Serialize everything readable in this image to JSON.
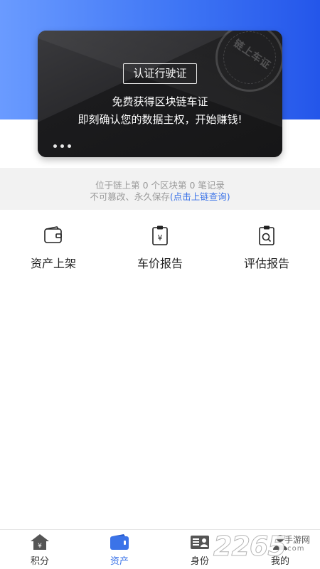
{
  "hero": {
    "certify_button": "认证行驶证",
    "line1": "免费获得区块链车证",
    "line2": "即刻确认您的数据主权，开始赚钱!",
    "seal_text": "链上车证",
    "colors": {
      "gradient_start": "#6a9bff",
      "gradient_end": "#2456ea",
      "card": "#1e1e20"
    }
  },
  "chain": {
    "record_line": "位于链上第 0 个区块第 0 笔记录",
    "tamper_prefix": "不可篡改、永久保存",
    "query_link": "(点击上链查询)"
  },
  "features": [
    {
      "label": "资产上架",
      "icon": "wallet-icon"
    },
    {
      "label": "车价报告",
      "icon": "price-report-icon"
    },
    {
      "label": "评估报告",
      "icon": "evaluation-report-icon"
    }
  ],
  "tabs": [
    {
      "label": "积分",
      "icon": "points-home-icon"
    },
    {
      "label": "资产",
      "icon": "asset-wallet-icon",
      "active": true
    },
    {
      "label": "身份",
      "icon": "id-card-icon"
    },
    {
      "label": "我的",
      "icon": "user-icon"
    }
  ],
  "watermark": {
    "number": "2265",
    "site_cn": "手游网",
    "site_en": ".com"
  },
  "accent_color": "#3b73e8"
}
